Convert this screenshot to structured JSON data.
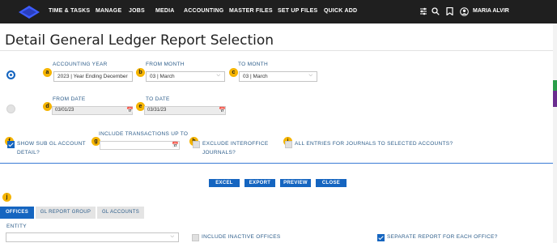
{
  "nav": {
    "items": [
      "TIME & TASKS",
      "MANAGE",
      "JOBS",
      "MEDIA",
      "ACCOUNTING",
      "MASTER FILES",
      "SET UP FILES",
      "QUICK ADD"
    ],
    "icons": [
      "sliders-icon",
      "search-icon",
      "bookmark-icon",
      "user-icon"
    ],
    "user_name": "MARIA ALVIR",
    "brand_color": "#3d5cff"
  },
  "page": {
    "title": "Detail General Ledger Report Selection"
  },
  "badges": [
    "a",
    "b",
    "c",
    "d",
    "e",
    "f",
    "g",
    "h",
    "i",
    "j"
  ],
  "period": {
    "accounting_year_label": "ACCOUNTING YEAR",
    "accounting_year_value": "2023 | Year Ending December",
    "from_month_label": "FROM MONTH",
    "from_month_value": "03 | March",
    "to_month_label": "TO MONTH",
    "to_month_value": "03 | March",
    "selected": true
  },
  "dates": {
    "from_date_label": "FROM DATE",
    "from_date_value": "03/01/23",
    "to_date_label": "TO DATE",
    "to_date_value": "03/31/23",
    "selected": false
  },
  "options": {
    "show_sub_gl_line1": "SHOW SUB GL ACCOUNT",
    "show_sub_gl_line2": "DETAIL?",
    "show_sub_gl_checked": true,
    "include_transactions_label": "INCLUDE TRANSACTIONS UP TO",
    "include_transactions_value": "",
    "exclude_interoffice_line1": "EXCLUDE INTEROFFICE",
    "exclude_interoffice_line2": "JOURNALS?",
    "exclude_interoffice_checked": false,
    "all_entries_label": "ALL ENTRIES FOR JOURNALS TO SELECTED ACCOUNTS?",
    "all_entries_checked": false
  },
  "actions": [
    "EXCEL",
    "EXPORT",
    "PREVIEW",
    "CLOSE"
  ],
  "tabs": [
    {
      "label": "OFFICES",
      "active": true
    },
    {
      "label": "GL REPORT GROUP",
      "active": false
    },
    {
      "label": "GL ACCOUNTS",
      "active": false
    }
  ],
  "offices": {
    "entity_label": "ENTITY",
    "entity_value": "",
    "include_inactive_label": "INCLUDE INACTIVE OFFICES",
    "include_inactive_checked": false,
    "separate_report_label": "SEPARATE REPORT FOR EACH OFFICE?",
    "separate_report_checked": true
  },
  "colors": {
    "accent": "#1565c0",
    "label": "#2d5d8a",
    "badge": "#f5b400",
    "topbar": "#1f1f1f"
  }
}
